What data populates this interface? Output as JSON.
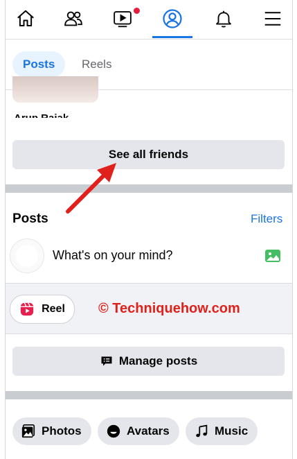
{
  "nav": {
    "items": [
      "home",
      "friends",
      "watch",
      "profile",
      "notifications",
      "menu"
    ],
    "active": "profile"
  },
  "tabs": [
    {
      "label": "Posts",
      "active": true
    },
    {
      "label": "Reels",
      "active": false
    }
  ],
  "friends": {
    "partial_name": "Arup Rajak",
    "see_all_label": "See all friends"
  },
  "posts": {
    "title": "Posts",
    "filters_label": "Filters",
    "composer_placeholder": "What's on your mind?",
    "reel_label": "Reel",
    "manage_label": "Manage posts"
  },
  "watermark": "© Techniquehow.com",
  "chips": [
    "Photos",
    "Avatars",
    "Music"
  ],
  "colors": {
    "accent": "#1b74e4",
    "annotation_red": "#e0201b",
    "reel_pink": "#e5204e",
    "photo_green": "#45bd62"
  }
}
